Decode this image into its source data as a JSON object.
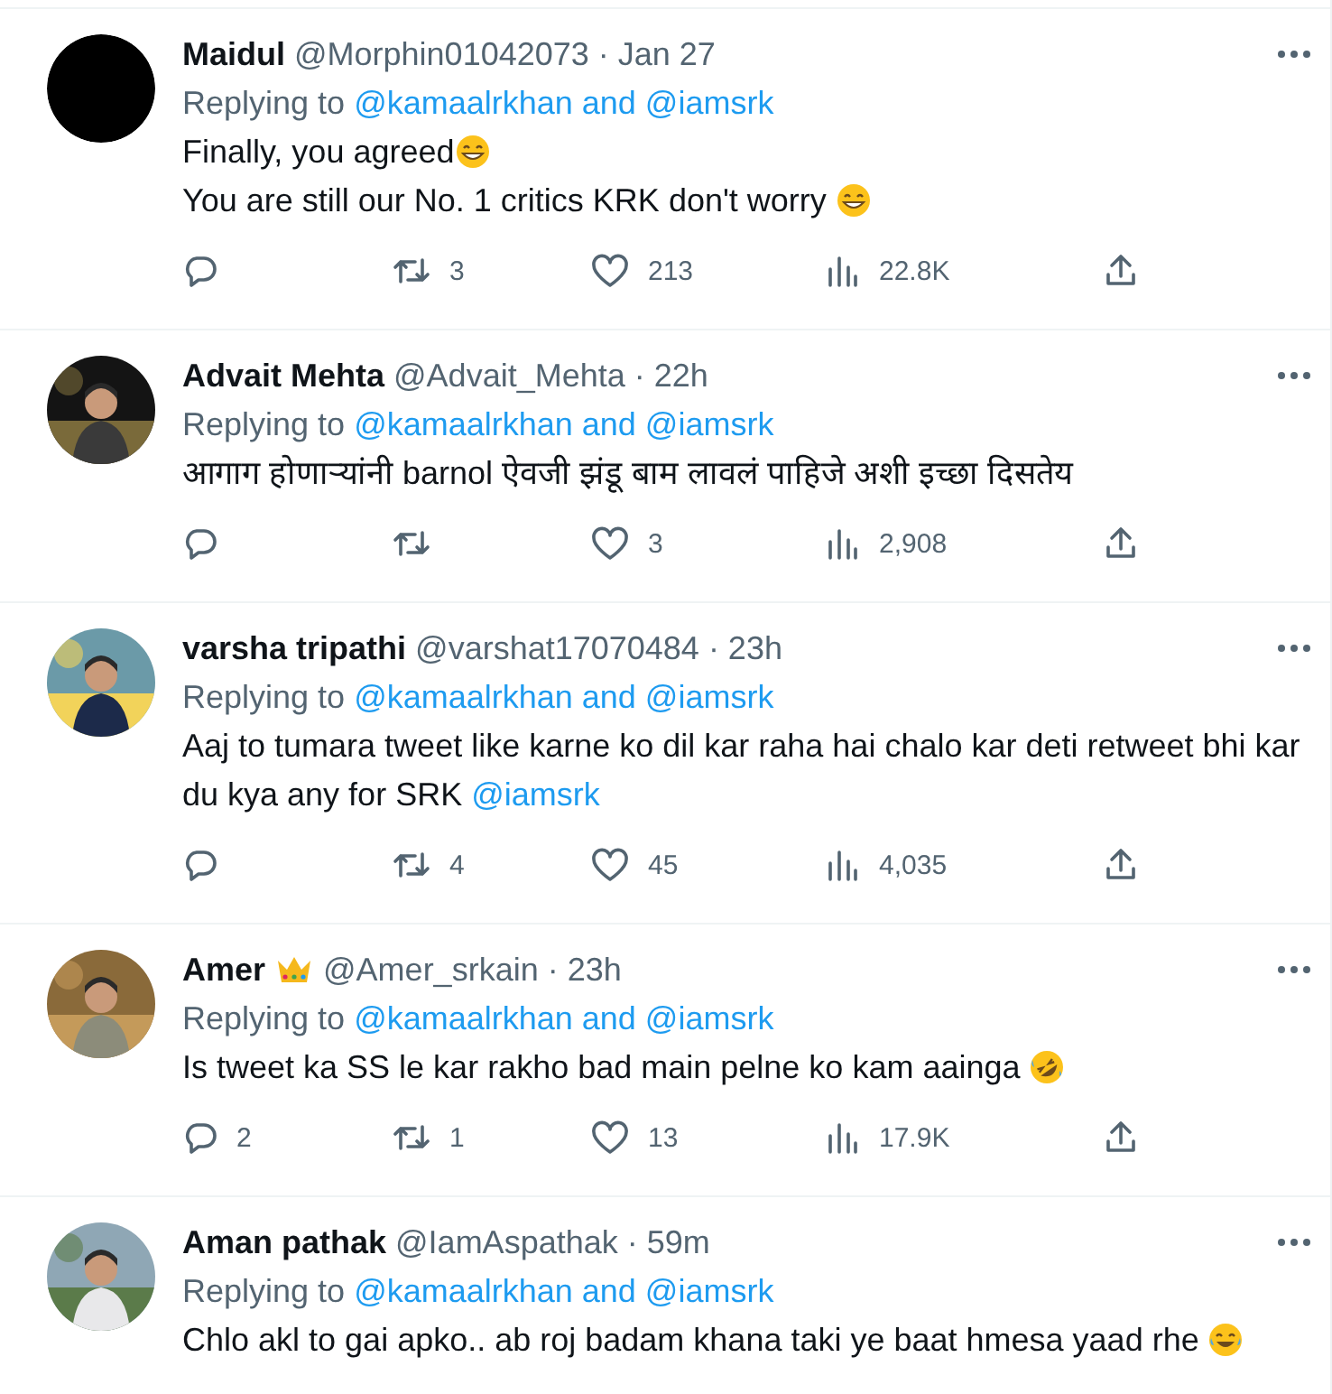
{
  "tweets": [
    {
      "avatar": {
        "kind": "plain"
      },
      "name": "Maidul",
      "handle": "@Morphin01042073",
      "time": "· Jan 27",
      "replying_prefix": "Replying to",
      "replying_to": "@kamaalrkhan and @iamsrk",
      "body": [
        {
          "kind": "text",
          "text": "Finally, you agreed"
        },
        {
          "kind": "grin"
        },
        {
          "kind": "break"
        },
        {
          "kind": "text",
          "text": "You are still our No. 1 critics KRK don't worry "
        },
        {
          "kind": "grin"
        }
      ],
      "actions": {
        "retweet": "3",
        "like": "213",
        "views": "22.8K"
      }
    },
    {
      "avatar": {
        "kind": "picture"
      },
      "name": "Advait Mehta",
      "handle": "@Advait_Mehta",
      "time": "· 22h",
      "replying_prefix": "Replying to",
      "replying_to": "@kamaalrkhan and @iamsrk",
      "body": [
        {
          "kind": "text",
          "text": "आगाग होणाऱ्यांनी barnol ऐवजी झंडू बाम लावलं पाहिजे अशी इच्छा दिसतेय"
        }
      ],
      "actions": {
        "like": "3",
        "views": "2,908"
      }
    },
    {
      "avatar": {
        "kind": "picture"
      },
      "name": "varsha tripathi",
      "handle": "@varshat17070484",
      "time": "· 23h",
      "replying_prefix": "Replying to",
      "replying_to": "@kamaalrkhan and @iamsrk",
      "body": [
        {
          "kind": "text",
          "text": "Aaj to tumara tweet like karne ko dil kar raha hai chalo kar deti retweet bhi kar du kya any for SRK "
        },
        {
          "kind": "mention",
          "text": "@iamsrk"
        }
      ],
      "actions": {
        "retweet": "4",
        "like": "45",
        "views": "4,035"
      }
    },
    {
      "avatar": {
        "kind": "picture"
      },
      "name": "Amer",
      "badge": {
        "kind": "crown"
      },
      "handle": "@Amer_srkain",
      "time": "· 23h",
      "replying_prefix": "Replying to",
      "replying_to": "@kamaalrkhan and @iamsrk",
      "body": [
        {
          "kind": "text",
          "text": "Is tweet ka SS le kar rakho bad main pelne ko kam aainga "
        },
        {
          "kind": "rofl"
        }
      ],
      "actions": {
        "reply": "2",
        "retweet": "1",
        "like": "13",
        "views": "17.9K"
      }
    },
    {
      "avatar": {
        "kind": "picture"
      },
      "name": "Aman pathak",
      "handle": "@IamAspathak",
      "time": "· 59m",
      "replying_prefix": "Replying to",
      "replying_to": "@kamaalrkhan and @iamsrk",
      "body": [
        {
          "kind": "text",
          "text": "Chlo akl to gai apko.. ab roj badam khana taki ye baat hmesa yaad rhe "
        },
        {
          "kind": "joy"
        }
      ]
    }
  ]
}
